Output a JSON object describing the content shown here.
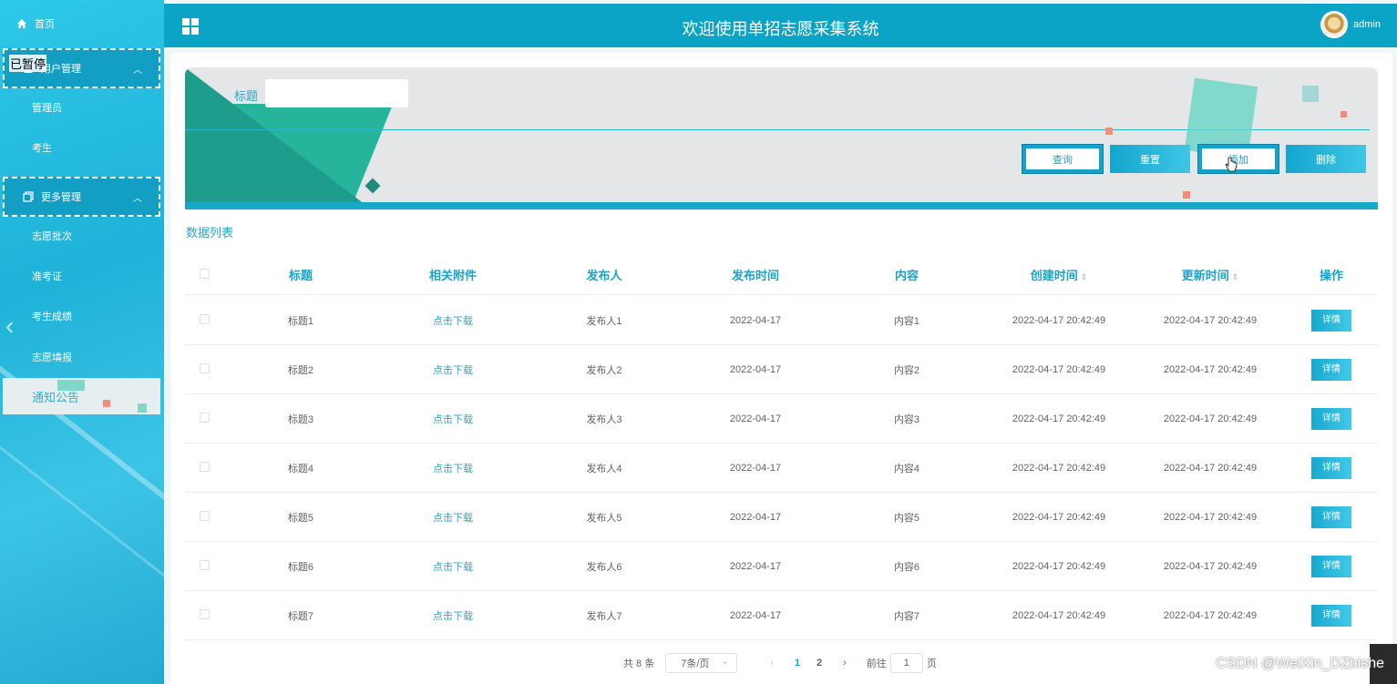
{
  "sidebar": {
    "home": "首页",
    "paused": "已暂停",
    "group1": "用户管理",
    "admin": "管理员",
    "student": "考生",
    "group2": "更多管理",
    "batch": "志愿批次",
    "ticket": "准考证",
    "score": "考生成绩",
    "fill": "志愿填报",
    "notice": "通知公告"
  },
  "header": {
    "title": "欢迎使用单招志愿采集系统",
    "user": "admin"
  },
  "search": {
    "label": "标题",
    "value": "",
    "buttons": {
      "query": "查询",
      "reset": "重置",
      "add": "添加",
      "delete": "删除"
    }
  },
  "list_title": "数据列表",
  "table": {
    "headers": [
      "标题",
      "相关附件",
      "发布人",
      "发布时间",
      "内容",
      "创建时间",
      "更新时间",
      "操作"
    ],
    "rows": [
      [
        "标题1",
        "点击下载",
        "发布人1",
        "2022-04-17",
        "内容1",
        "2022-04-17 20:42:49",
        "2022-04-17 20:42:49",
        "详情"
      ],
      [
        "标题2",
        "点击下载",
        "发布人2",
        "2022-04-17",
        "内容2",
        "2022-04-17 20:42:49",
        "2022-04-17 20:42:49",
        "详情"
      ],
      [
        "标题3",
        "点击下载",
        "发布人3",
        "2022-04-17",
        "内容3",
        "2022-04-17 20:42:49",
        "2022-04-17 20:42:49",
        "详情"
      ],
      [
        "标题4",
        "点击下载",
        "发布人4",
        "2022-04-17",
        "内容4",
        "2022-04-17 20:42:49",
        "2022-04-17 20:42:49",
        "详情"
      ],
      [
        "标题5",
        "点击下载",
        "发布人5",
        "2022-04-17",
        "内容5",
        "2022-04-17 20:42:49",
        "2022-04-17 20:42:49",
        "详情"
      ],
      [
        "标题6",
        "点击下载",
        "发布人6",
        "2022-04-17",
        "内容6",
        "2022-04-17 20:42:49",
        "2022-04-17 20:42:49",
        "详情"
      ],
      [
        "标题7",
        "点击下载",
        "发布人7",
        "2022-04-17",
        "内容7",
        "2022-04-17 20:42:49",
        "2022-04-17 20:42:49",
        "详情"
      ]
    ]
  },
  "pagination": {
    "total": "共 8 条",
    "page_size": "7条/页",
    "pages": [
      "1",
      "2"
    ],
    "current": "1",
    "goto_prefix": "前往",
    "goto_value": "1",
    "goto_suffix": "页"
  },
  "watermark": "CSDN @WeiXin_DZbishe",
  "colors": {
    "primary": "#0ba4c7",
    "accent": "#2aa7c9",
    "sidebar": "#1fb2d8"
  }
}
